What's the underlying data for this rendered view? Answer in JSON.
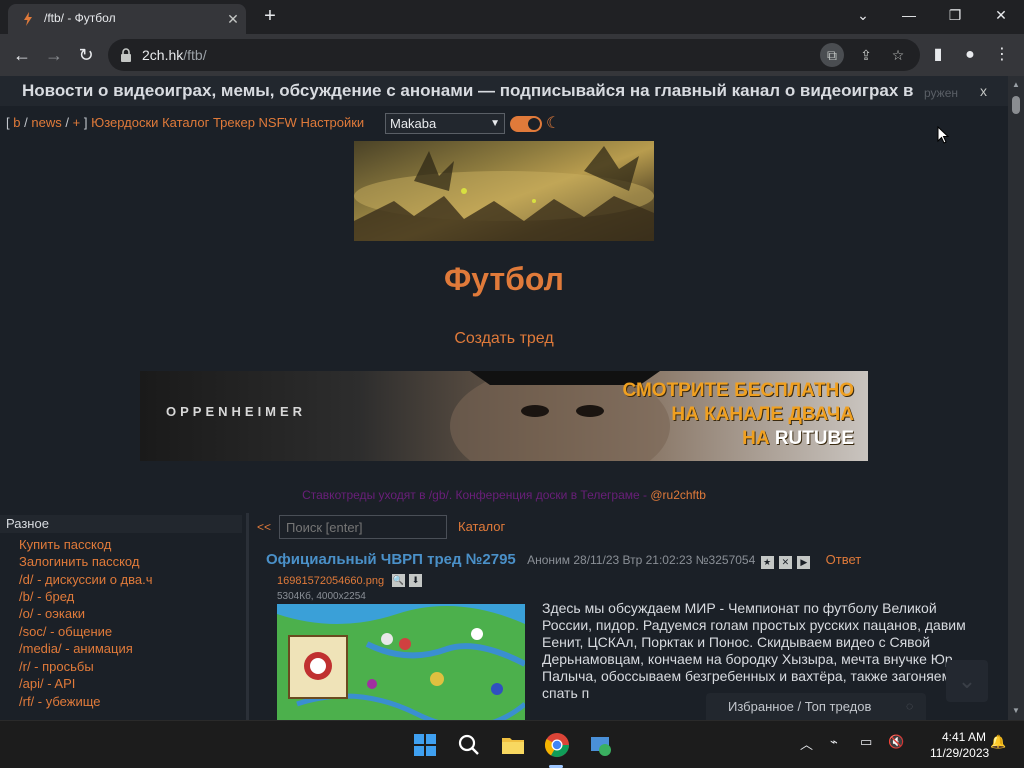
{
  "browser": {
    "tab_title": "/ftb/ - Футбол",
    "url_host": "2ch.hk",
    "url_path": "/ftb/"
  },
  "page": {
    "top_banner": "Новости о видеоиграх, мемы, обсуждение с анонами — подписывайся на главный канал о видеоиграх в",
    "top_banner_faded": "ружен",
    "top_banner_close": "x",
    "nav": {
      "open_bracket": "[",
      "b": "b",
      "sep1": "/",
      "news": "news",
      "sep2": "/",
      "plus": "+",
      "close_bracket": "]",
      "userboards": "Юзердоски",
      "catalog": "Каталог",
      "tracker": "Трекер",
      "nsfw": "NSFW",
      "settings": "Настройки"
    },
    "style_select_value": "Makaba",
    "board_title": "Футбол",
    "create_thread": "Создать тред",
    "ad": {
      "brand": "OPPENHEIMER",
      "line1": "СМОТРИТЕ БЕСПЛАТНО",
      "line2": "НА КАНАЛЕ ДВАЧА",
      "line3_pre": "НА ",
      "line3_brand": "RUTUBE"
    },
    "announce_text": "Ставкотреды уходят в /gb/. Конференция доски в Телеграме - ",
    "announce_link": "@ru2chftb",
    "sidebar": {
      "heading": "Разное",
      "items": [
        {
          "label": "Купить пасскод",
          "desc": ""
        },
        {
          "label": "Залогинить пасскод",
          "desc": ""
        },
        {
          "label": "/d/",
          "desc": " - дискуссии о два.ч"
        },
        {
          "label": "/b/",
          "desc": " - бред"
        },
        {
          "label": "/o/",
          "desc": " - оэкаки"
        },
        {
          "label": "/soc/",
          "desc": " - общение"
        },
        {
          "label": "/media/",
          "desc": " - анимация"
        },
        {
          "label": "/r/",
          "desc": " - просьбы"
        },
        {
          "label": "/api/",
          "desc": " - API"
        },
        {
          "label": "/rf/",
          "desc": " - убежище"
        }
      ]
    },
    "back_link": "<<",
    "search_placeholder": "Поиск [enter]",
    "catalog_link": "Каталог",
    "thread": {
      "subject": "Официальный ЧВРП тред №2795",
      "author": "Аноним",
      "datetime": "28/11/23 Втр 21:02:23",
      "number": "№3257054",
      "reply": "Ответ",
      "file_name": "16981572054660.png",
      "file_meta": "5304Кб, 4000x2254",
      "body": "Здесь мы обсуждаем МИР - Чемпионат по футболу Великой России, пидор. Радуемся голам простых русских пацанов, давим Еенит, ЦСКАл, Порктак и Понос. Скидываем видео с Сявой Дерьнамовцам, кончаем на бородку Хызыра, мечта внучке Юр. Палыча, обоссываем безгребенных и вахтёра, также загоняем спать п"
    },
    "fav_bar": "Избранное / Топ тредов"
  },
  "taskbar": {
    "time": "4:41 AM",
    "date": "11/29/2023"
  },
  "colors": {
    "accent": "#e07a3a",
    "background": "#1b2027",
    "subject": "#4a90c8"
  }
}
